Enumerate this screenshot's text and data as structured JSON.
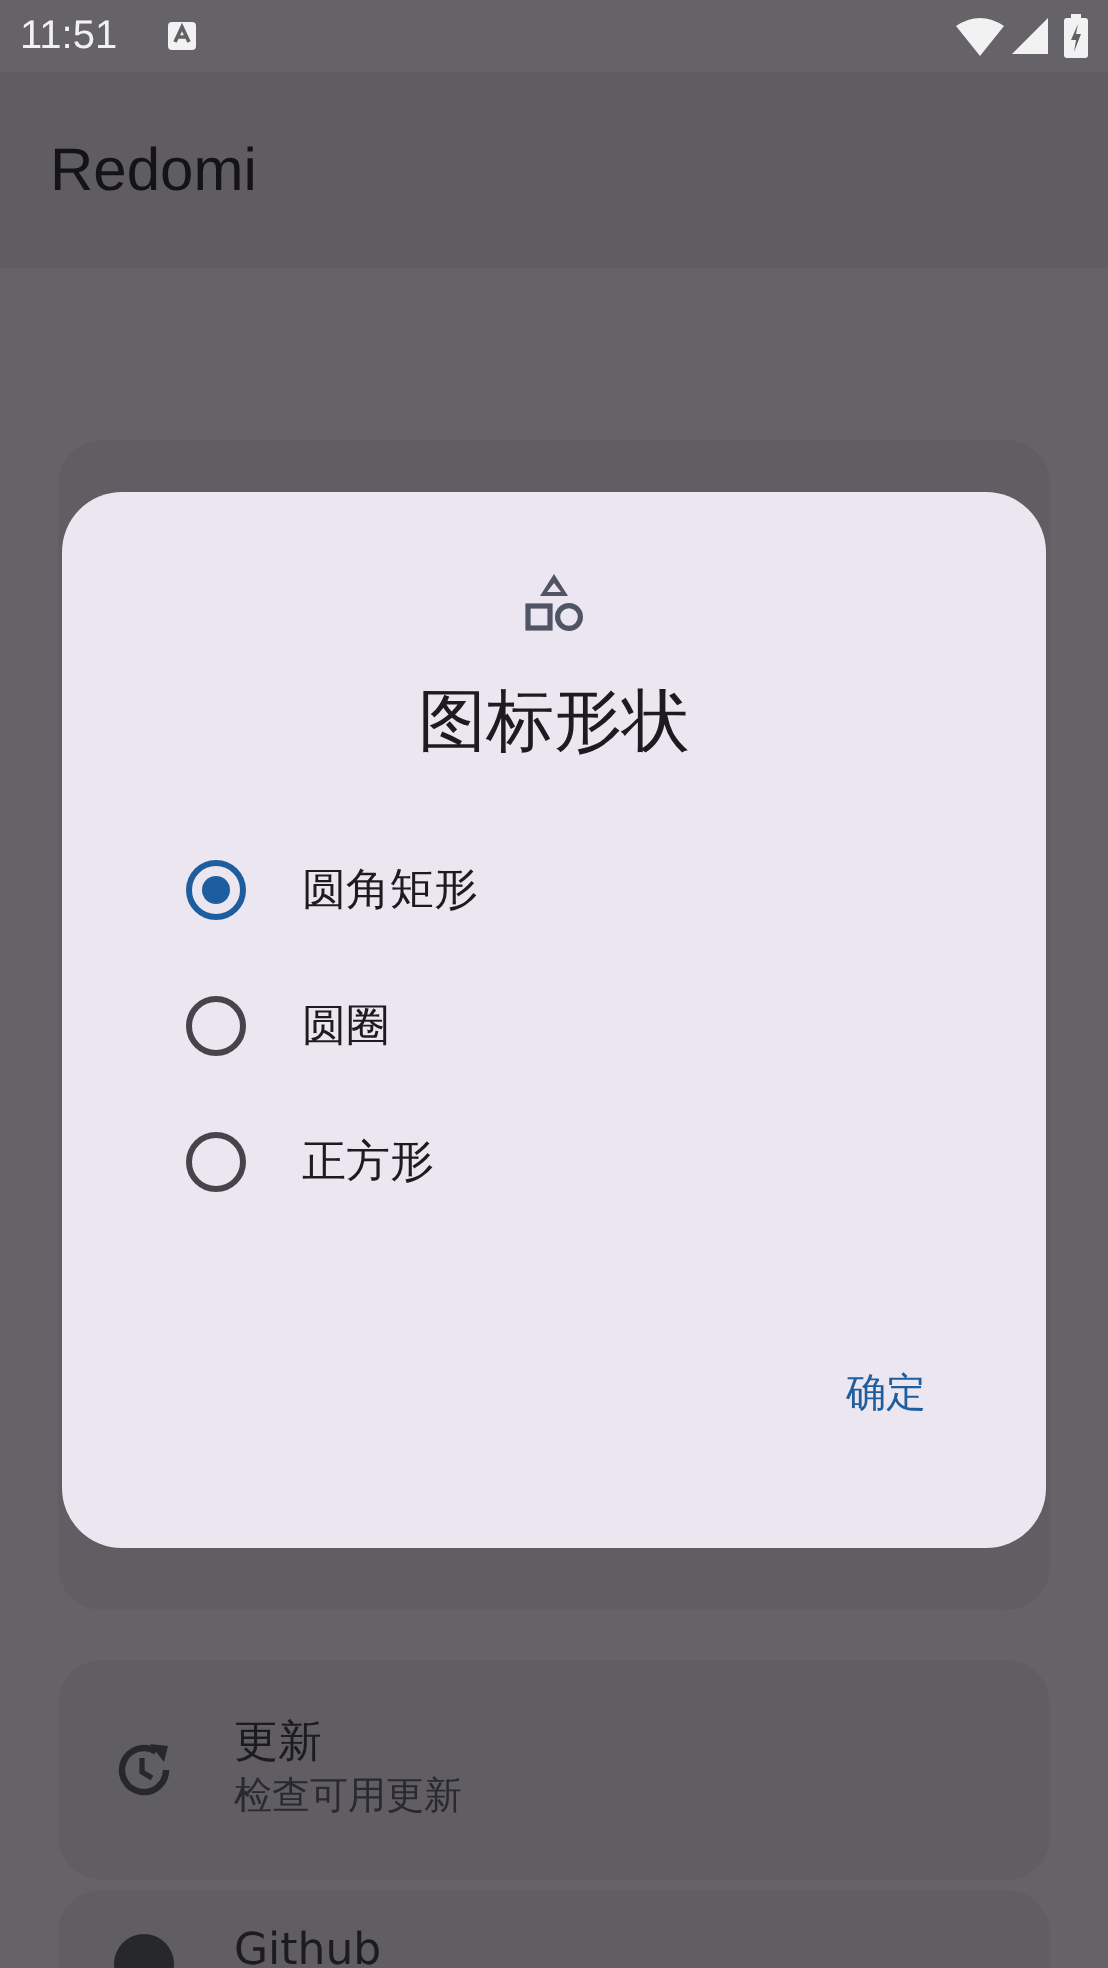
{
  "status_bar": {
    "time": "11:51"
  },
  "app_bar": {
    "title": "Redomi"
  },
  "settings": [
    {
      "kind": "update",
      "title": "更新",
      "subtitle": "检查可用更新"
    },
    {
      "kind": "github",
      "title": "Github"
    }
  ],
  "dialog": {
    "title": "图标形状",
    "options": [
      {
        "label": "圆角矩形",
        "selected": true
      },
      {
        "label": "圆圈",
        "selected": false
      },
      {
        "label": "正方形",
        "selected": false
      }
    ],
    "buttons": [
      "确定"
    ]
  }
}
